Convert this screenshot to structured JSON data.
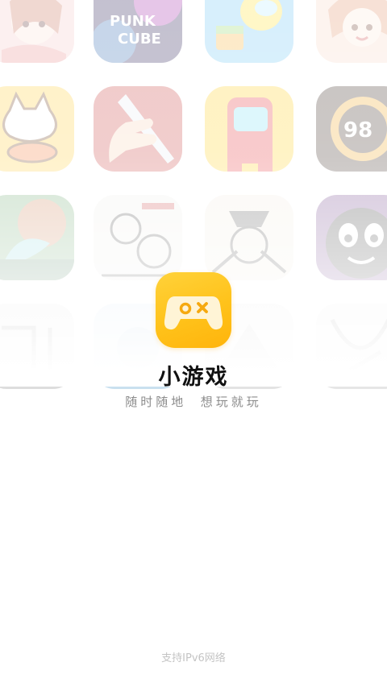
{
  "app": {
    "name": "小游戏",
    "slogan": "随时随地  想玩就玩",
    "logo_colors": [
      "#ffd23a",
      "#ffb40c"
    ]
  },
  "footer": {
    "network_note": "支持IPv6网络"
  },
  "background_games": [
    {
      "icon": "anime-girl-game-icon"
    },
    {
      "icon": "punk-cube-game-icon"
    },
    {
      "icon": "yellow-robot-cube-game-icon"
    },
    {
      "icon": "cartoon-girl-game-icon"
    },
    {
      "icon": "lucky-cat-fish-game-icon"
    },
    {
      "icon": "knife-hand-game-icon"
    },
    {
      "icon": "red-crewmate-game-icon"
    },
    {
      "icon": "score-ring-game-icon"
    },
    {
      "icon": "dragon-warrior-game-icon"
    },
    {
      "icon": "detective-comic-game-icon"
    },
    {
      "icon": "pirate-battle-game-icon"
    },
    {
      "icon": "dark-blob-face-game-icon"
    },
    {
      "icon": "sketch-game-icon-1"
    },
    {
      "icon": "sketch-game-icon-2"
    },
    {
      "icon": "sketch-game-icon-3"
    },
    {
      "icon": "sketch-game-icon-4"
    }
  ]
}
